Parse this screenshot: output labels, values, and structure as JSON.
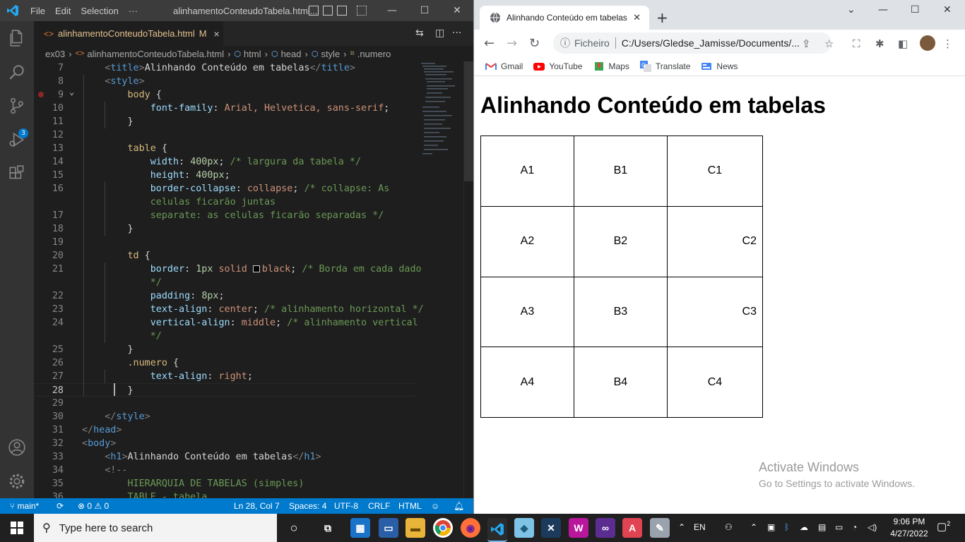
{
  "vscode": {
    "menu": [
      "File",
      "Edit",
      "Selection",
      "···"
    ],
    "title": "alinhamentoConteudoTabela.html...",
    "tab": {
      "label": "alinhamentoConteudoTabela.html",
      "modified": "M",
      "close": "×"
    },
    "breadcrumb": [
      "ex03",
      "alinhamentoConteudoTabela.html",
      "html",
      "head",
      "style",
      ".numero"
    ],
    "scm_badge": "3",
    "code_lines": [
      {
        "n": "7",
        "parts": [
          [
            "i",
            "    "
          ],
          [
            "br",
            "<"
          ],
          [
            "tag",
            "title"
          ],
          [
            "br",
            ">"
          ],
          [
            "txt",
            "Alinhando Conteúdo em tabelas"
          ],
          [
            "br",
            "</"
          ],
          [
            "tag",
            "title"
          ],
          [
            "br",
            ">"
          ]
        ]
      },
      {
        "n": "8",
        "parts": [
          [
            "i",
            "    "
          ],
          [
            "br",
            "<"
          ],
          [
            "tag",
            "style"
          ],
          [
            "br",
            ">"
          ]
        ]
      },
      {
        "n": "9",
        "parts": [
          [
            "i",
            "        "
          ],
          [
            "sel",
            "body"
          ],
          [
            "txt",
            " {"
          ]
        ]
      },
      {
        "n": "10",
        "parts": [
          [
            "i",
            "            "
          ],
          [
            "prop",
            "font-family"
          ],
          [
            "txt",
            ": "
          ],
          [
            "val",
            "Arial, Helvetica, sans-serif"
          ],
          [
            "txt",
            ";"
          ]
        ]
      },
      {
        "n": "11",
        "parts": [
          [
            "i",
            "        "
          ],
          [
            "txt",
            "}"
          ]
        ]
      },
      {
        "n": "12",
        "parts": []
      },
      {
        "n": "13",
        "parts": [
          [
            "i",
            "        "
          ],
          [
            "sel",
            "table"
          ],
          [
            "txt",
            " {"
          ]
        ]
      },
      {
        "n": "14",
        "parts": [
          [
            "i",
            "            "
          ],
          [
            "prop",
            "width"
          ],
          [
            "txt",
            ": "
          ],
          [
            "num",
            "400px"
          ],
          [
            "txt",
            "; "
          ],
          [
            "com",
            "/* largura da tabela */"
          ]
        ]
      },
      {
        "n": "15",
        "parts": [
          [
            "i",
            "            "
          ],
          [
            "prop",
            "height"
          ],
          [
            "txt",
            ": "
          ],
          [
            "num",
            "400px"
          ],
          [
            "txt",
            ";"
          ]
        ]
      },
      {
        "n": "16",
        "parts": [
          [
            "i",
            "            "
          ],
          [
            "prop",
            "border-collapse"
          ],
          [
            "txt",
            ": "
          ],
          [
            "val",
            "collapse"
          ],
          [
            "txt",
            "; "
          ],
          [
            "com",
            "/* collapse: As"
          ]
        ]
      },
      {
        "n": "",
        "parts": [
          [
            "i",
            "            "
          ],
          [
            "com",
            "celulas ficarão juntas"
          ]
        ]
      },
      {
        "n": "17",
        "parts": [
          [
            "i",
            "            "
          ],
          [
            "com",
            "separate: as celulas ficarão separadas */"
          ]
        ]
      },
      {
        "n": "18",
        "parts": [
          [
            "i",
            "        "
          ],
          [
            "txt",
            "}"
          ]
        ]
      },
      {
        "n": "19",
        "parts": []
      },
      {
        "n": "20",
        "parts": [
          [
            "i",
            "        "
          ],
          [
            "sel",
            "td"
          ],
          [
            "txt",
            " {"
          ]
        ]
      },
      {
        "n": "21",
        "parts": [
          [
            "i",
            "            "
          ],
          [
            "prop",
            "border"
          ],
          [
            "txt",
            ": "
          ],
          [
            "num",
            "1px"
          ],
          [
            "txt",
            " "
          ],
          [
            "val",
            "solid "
          ],
          [
            "sw",
            " "
          ],
          [
            "val",
            "black"
          ],
          [
            "txt",
            "; "
          ],
          [
            "com",
            "/* Borda em cada dado"
          ]
        ]
      },
      {
        "n": "",
        "parts": [
          [
            "i",
            "            "
          ],
          [
            "com",
            "*/"
          ]
        ]
      },
      {
        "n": "22",
        "parts": [
          [
            "i",
            "            "
          ],
          [
            "prop",
            "padding"
          ],
          [
            "txt",
            ": "
          ],
          [
            "num",
            "8px"
          ],
          [
            "txt",
            ";"
          ]
        ]
      },
      {
        "n": "23",
        "parts": [
          [
            "i",
            "            "
          ],
          [
            "prop",
            "text-align"
          ],
          [
            "txt",
            ": "
          ],
          [
            "val",
            "center"
          ],
          [
            "txt",
            "; "
          ],
          [
            "com",
            "/* alinhamento horizontal */"
          ]
        ]
      },
      {
        "n": "24",
        "parts": [
          [
            "i",
            "            "
          ],
          [
            "prop",
            "vertical-align"
          ],
          [
            "txt",
            ": "
          ],
          [
            "val",
            "middle"
          ],
          [
            "txt",
            "; "
          ],
          [
            "com",
            "/* alinhamento vertical"
          ]
        ]
      },
      {
        "n": "",
        "parts": [
          [
            "i",
            "            "
          ],
          [
            "com",
            "*/"
          ]
        ]
      },
      {
        "n": "25",
        "parts": [
          [
            "i",
            "        "
          ],
          [
            "txt",
            "}"
          ]
        ]
      },
      {
        "n": "26",
        "parts": [
          [
            "i",
            "        "
          ],
          [
            "sel",
            ".numero"
          ],
          [
            "txt",
            " {"
          ]
        ]
      },
      {
        "n": "27",
        "parts": [
          [
            "i",
            "            "
          ],
          [
            "prop",
            "text-align"
          ],
          [
            "txt",
            ": "
          ],
          [
            "val",
            "right"
          ],
          [
            "txt",
            ";"
          ]
        ]
      },
      {
        "n": "28",
        "parts": [
          [
            "i",
            "        "
          ],
          [
            "txt",
            "}"
          ]
        ]
      },
      {
        "n": "29",
        "parts": []
      },
      {
        "n": "30",
        "parts": [
          [
            "i",
            "    "
          ],
          [
            "br",
            "</"
          ],
          [
            "tag",
            "style"
          ],
          [
            "br",
            ">"
          ]
        ]
      },
      {
        "n": "31",
        "parts": [
          [
            "br",
            "</"
          ],
          [
            "tag",
            "head"
          ],
          [
            "br",
            ">"
          ]
        ]
      },
      {
        "n": "32",
        "parts": [
          [
            "br",
            "<"
          ],
          [
            "tag",
            "body"
          ],
          [
            "br",
            ">"
          ]
        ]
      },
      {
        "n": "33",
        "parts": [
          [
            "i",
            "    "
          ],
          [
            "br",
            "<"
          ],
          [
            "tag",
            "h1"
          ],
          [
            "br",
            ">"
          ],
          [
            "txt",
            "Alinhando Conteúdo em tabelas"
          ],
          [
            "br",
            "</"
          ],
          [
            "tag",
            "h1"
          ],
          [
            "br",
            ">"
          ]
        ]
      },
      {
        "n": "34",
        "parts": [
          [
            "i",
            "    "
          ],
          [
            "br",
            "<!--"
          ]
        ]
      },
      {
        "n": "35",
        "parts": [
          [
            "i",
            "        "
          ],
          [
            "com",
            "HIERARQUIA DE TABELAS (simples)"
          ]
        ]
      },
      {
        "n": "36",
        "parts": [
          [
            "i",
            "        "
          ],
          [
            "com",
            "TABLE - tabela"
          ]
        ]
      }
    ],
    "status": {
      "branch": "main*",
      "problems": "⊗ 0 ⚠ 0",
      "position": "Ln 28, Col 7",
      "spaces": "Spaces: 4",
      "encoding": "UTF-8",
      "eol": "CRLF",
      "language": "HTML"
    }
  },
  "chrome": {
    "tab_title": "Alinhando Conteúdo em tabelas",
    "omnibox": {
      "scheme": "Ficheiro",
      "url": "C:/Users/Gledse_Jamisse/Documents/..."
    },
    "bookmarks": [
      "Gmail",
      "YouTube",
      "Maps",
      "Translate",
      "News"
    ],
    "page": {
      "heading": "Alinhando Conteúdo em tabelas",
      "table": [
        [
          "A1",
          "B1",
          "C1"
        ],
        [
          "A2",
          "B2",
          "C2"
        ],
        [
          "A3",
          "B3",
          "C3"
        ],
        [
          "A4",
          "B4",
          "C4"
        ]
      ]
    },
    "activate": {
      "title": "Activate Windows",
      "subtitle": "Go to Settings to activate Windows."
    }
  },
  "taskbar": {
    "search_placeholder": "Type here to search",
    "language": "EN",
    "time": "9:06 PM",
    "date": "4/27/2022",
    "notifications": "2"
  },
  "colors": {
    "vscode_accent": "#007acc",
    "chrome_frame": "#dee1e6",
    "taskbar": "#202020"
  }
}
